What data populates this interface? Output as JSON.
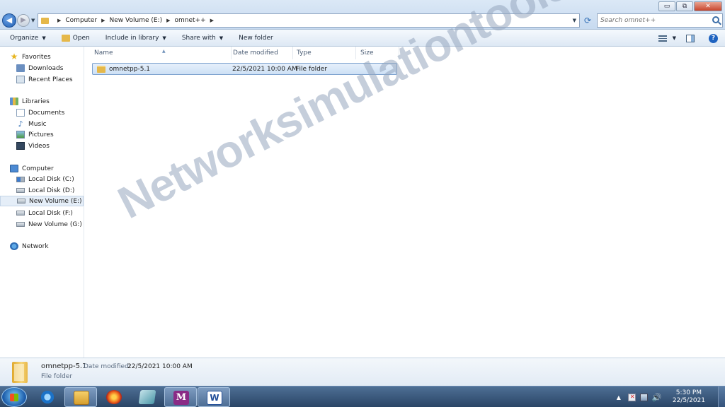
{
  "window": {
    "minimize": "▭",
    "maximize": "⧉",
    "close": "✕"
  },
  "nav": {
    "back": "◀",
    "forward": "▶"
  },
  "address": {
    "crumbs": [
      "Computer",
      "New Volume (E:)",
      "omnet++"
    ]
  },
  "search": {
    "placeholder": "Search omnet++"
  },
  "toolbar": {
    "organize": "Organize",
    "open": "Open",
    "include_in_library": "Include in library",
    "share_with": "Share with",
    "new_folder": "New folder",
    "help": "?"
  },
  "sidebar": {
    "favorites": {
      "label": "Favorites",
      "items": [
        "Downloads",
        "Recent Places"
      ]
    },
    "libraries": {
      "label": "Libraries",
      "items": [
        "Documents",
        "Music",
        "Pictures",
        "Videos"
      ]
    },
    "computer": {
      "label": "Computer",
      "items": [
        "Local Disk (C:)",
        "Local Disk (D:)",
        "New Volume (E:)",
        "Local Disk (F:)",
        "New Volume (G:)"
      ],
      "selected": "New Volume (E:)"
    },
    "network": {
      "label": "Network"
    }
  },
  "columns": [
    "Name",
    "Date modified",
    "Type",
    "Size"
  ],
  "files": [
    {
      "name": "omnetpp-5.1",
      "date_modified": "22/5/2021 10:00 AM",
      "type": "File folder",
      "size": ""
    }
  ],
  "details": {
    "name": "omnetpp-5.1",
    "modified_label": "Date modified:",
    "modified_value": "22/5/2021 10:00 AM",
    "type": "File folder"
  },
  "watermark": "Networksimulationtools.com",
  "taskbar": {
    "apps": [
      "internet-explorer",
      "windows-explorer",
      "firefox",
      "vmware",
      "omnet-ide",
      "word"
    ],
    "active_app": "windows-explorer",
    "omnet_glyph": "M",
    "word_glyph": "W",
    "time": "5:30 PM",
    "date": "22/5/2021"
  }
}
